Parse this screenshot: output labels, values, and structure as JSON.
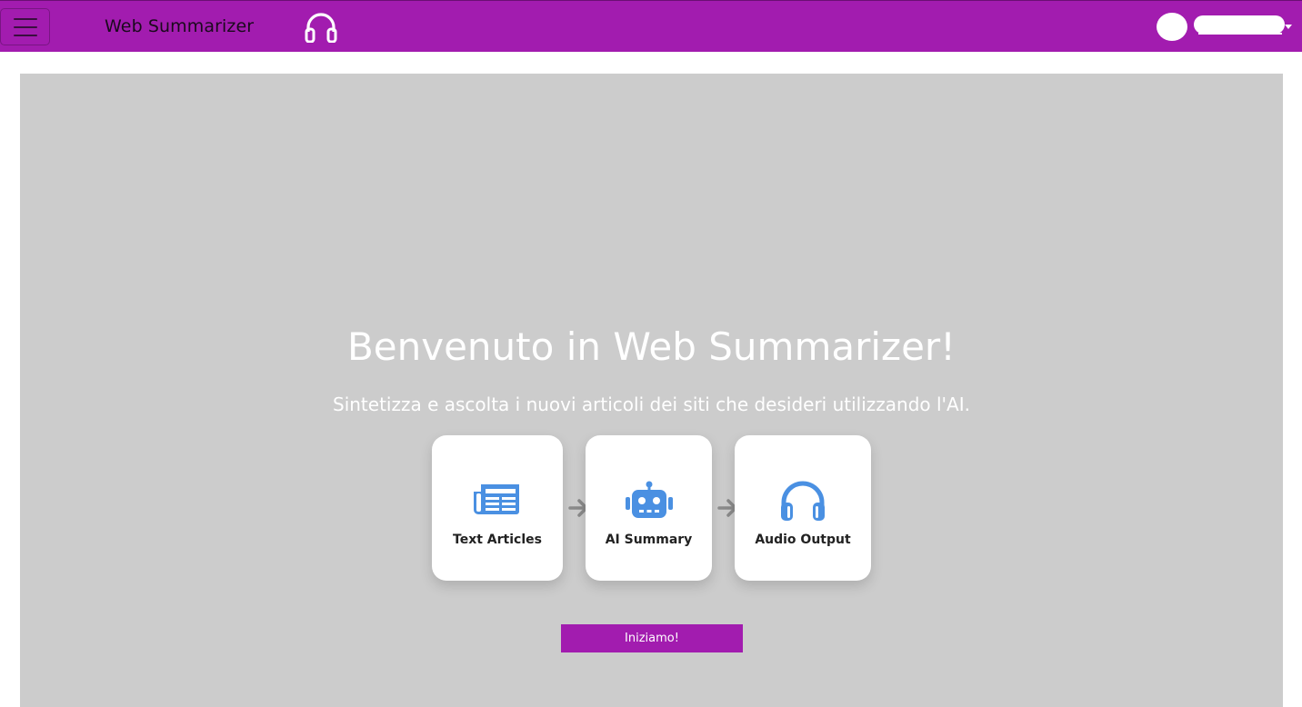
{
  "navbar": {
    "brand": "Web Summarizer",
    "menu_icon": "hamburger-menu-icon",
    "brand_icon": "headphones-icon",
    "background_color": "#a21caf"
  },
  "user_menu": {
    "avatar_icon": "user-avatar",
    "caret_icon": "caret-down-icon"
  },
  "hero": {
    "title": "Benvenuto in Web Summarizer!",
    "subtitle": "Sintetizza e ascolta i nuovi articoli dei siti che desideri utilizzando l'AI.",
    "background_color": "#cccccc"
  },
  "steps": [
    {
      "label": "Text Articles",
      "icon": "newspaper-icon"
    },
    {
      "label": "AI Summary",
      "icon": "robot-icon"
    },
    {
      "label": "Audio Output",
      "icon": "headphones-icon"
    }
  ],
  "step_arrow_icon": "arrow-right-icon",
  "icon_color": "#4a90e2",
  "cta": {
    "label": "Iniziamo!"
  }
}
